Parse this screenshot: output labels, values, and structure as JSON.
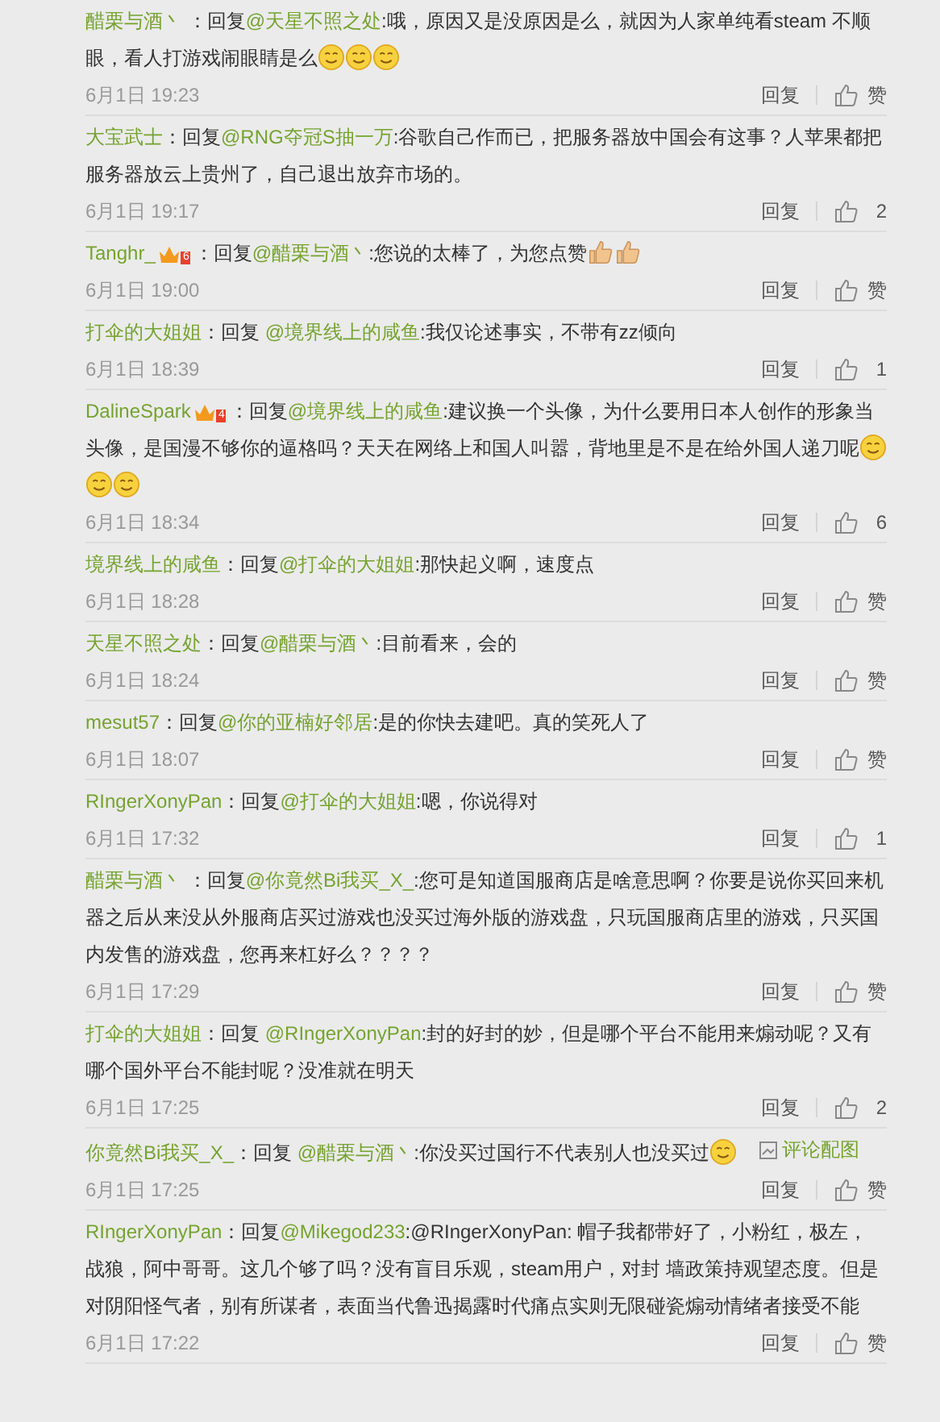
{
  "comments": [
    {
      "user": "醋栗与酒丶",
      "prefix": " ：回复",
      "target": "@天星不照之处",
      "body": [
        {
          "kind": "text",
          "text": ":哦，原因又是没原因是么，就因为人家单纯看steam 不顺眼，看人打游戏闹眼睛是么"
        },
        {
          "kind": "emoji"
        },
        {
          "kind": "emoji"
        },
        {
          "kind": "emoji"
        }
      ],
      "time": "6月1日 19:23",
      "reply": "回复",
      "likes": "赞"
    },
    {
      "user": "大宝武士",
      "prefix": "：回复",
      "target": "@RNG夺冠S抽一万",
      "body": [
        {
          "kind": "text",
          "text": ":谷歌自己作而已，把服务器放中国会有这事？人苹果都把服务器放云上贵州了，自己退出放弃市场的。"
        }
      ],
      "time": "6月1日 19:17",
      "reply": "回复",
      "likes": "2"
    },
    {
      "user": "Tanghr_",
      "badge": "6",
      "prefix": "：回复",
      "target": "@醋栗与酒丶",
      "body": [
        {
          "kind": "text",
          "text": ":您说的太棒了，为您点赞"
        },
        {
          "kind": "thumb"
        },
        {
          "kind": "thumb"
        }
      ],
      "time": "6月1日 19:00",
      "reply": "回复",
      "likes": "赞"
    },
    {
      "user": "打伞的大姐姐",
      "prefix": "：回复 ",
      "target": "@境界线上的咸鱼",
      "body": [
        {
          "kind": "text",
          "text": ":我仅论述事实，不带有zz倾向"
        }
      ],
      "time": "6月1日 18:39",
      "reply": "回复",
      "likes": "1"
    },
    {
      "user": "DalineSpark",
      "badge": "4",
      "prefix": "：回复",
      "target": "@境界线上的咸鱼",
      "body": [
        {
          "kind": "text",
          "text": ":建议换一个头像，为什么要用日本人创作的形象当头像，是国漫不够你的逼格吗？天天在网络上和国人叫嚣，背地里是不是在给外国人递刀呢"
        },
        {
          "kind": "emoji"
        },
        {
          "kind": "emoji"
        },
        {
          "kind": "emoji"
        }
      ],
      "time": "6月1日 18:34",
      "reply": "回复",
      "likes": "6"
    },
    {
      "user": "境界线上的咸鱼",
      "prefix": "：回复",
      "target": "@打伞的大姐姐",
      "body": [
        {
          "kind": "text",
          "text": ":那快起义啊，速度点"
        }
      ],
      "time": "6月1日 18:28",
      "reply": "回复",
      "likes": "赞"
    },
    {
      "user": "天星不照之处",
      "prefix": "：回复",
      "target": "@醋栗与酒丶",
      "body": [
        {
          "kind": "text",
          "text": ":目前看来，会的"
        }
      ],
      "time": "6月1日 18:24",
      "reply": "回复",
      "likes": "赞"
    },
    {
      "user": "mesut57",
      "prefix": "：回复",
      "target": "@你的亚楠好邻居",
      "body": [
        {
          "kind": "text",
          "text": ":是的你快去建吧。真的笑死人了"
        }
      ],
      "time": "6月1日 18:07",
      "reply": "回复",
      "likes": "赞"
    },
    {
      "user": "RIngerXonyPan",
      "prefix": "：回复",
      "target": "@打伞的大姐姐",
      "body": [
        {
          "kind": "text",
          "text": ":嗯，你说得对"
        }
      ],
      "time": "6月1日 17:32",
      "reply": "回复",
      "likes": "1"
    },
    {
      "user": "醋栗与酒丶",
      "prefix": " ：回复",
      "target": "@你竟然Bi我买_X_",
      "body": [
        {
          "kind": "text",
          "text": ":您可是知道国服商店是啥意思啊？你要是说你买回来机器之后从来没从外服商店买过游戏也没买过海外版的游戏盘，只玩国服商店里的游戏，只买国内发售的游戏盘，您再来杠好么？？？？"
        }
      ],
      "time": "6月1日 17:29",
      "reply": "回复",
      "likes": "赞"
    },
    {
      "user": "打伞的大姐姐",
      "prefix": "：回复 ",
      "target": "@RIngerXonyPan",
      "body": [
        {
          "kind": "text",
          "text": ":封的好封的妙，但是哪个平台不能用来煽动呢？又有哪个国外平台不能封呢？没准就在明天"
        }
      ],
      "time": "6月1日 17:25",
      "reply": "回复",
      "likes": "2"
    },
    {
      "user": "你竟然Bi我买_X_",
      "prefix": "：回复 ",
      "target": "@醋栗与酒丶",
      "body": [
        {
          "kind": "text",
          "text": ":你没买过国行不代表别人也没买过"
        },
        {
          "kind": "emoji"
        }
      ],
      "image_link": "评论配图",
      "time": "6月1日 17:25",
      "reply": "回复",
      "likes": "赞"
    },
    {
      "user": "RIngerXonyPan",
      "prefix": "：回复",
      "target": "@Mikegod233",
      "body": [
        {
          "kind": "text",
          "text": ":@RIngerXonyPan: 帽子我都带好了，小粉红，极左，战狼，阿中哥哥。这几个够了吗？没有盲目乐观，steam用户，对封 墙政策持观望态度。但是对阴阳怪气者，别有所谋者，表面当代鲁迅揭露时代痛点实则无限碰瓷煽动情绪者接受不能"
        }
      ],
      "time": "6月1日 17:22",
      "reply": "回复",
      "likes": "赞"
    }
  ]
}
